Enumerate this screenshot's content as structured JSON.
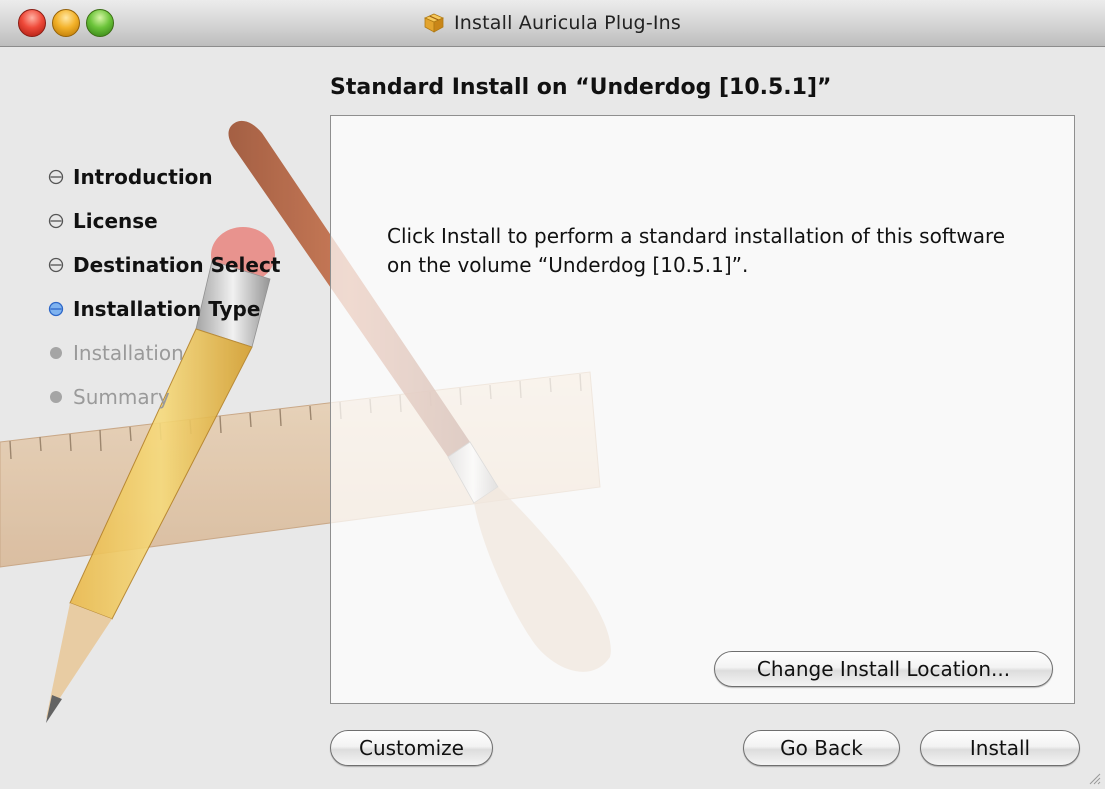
{
  "window": {
    "title": "Install Auricula Plug-Ins"
  },
  "heading": "Standard Install on “Underdog [10.5.1]”",
  "steps": [
    {
      "label": "Introduction",
      "state": "done"
    },
    {
      "label": "License",
      "state": "done"
    },
    {
      "label": "Destination Select",
      "state": "done"
    },
    {
      "label": "Installation Type",
      "state": "current"
    },
    {
      "label": "Installation",
      "state": "todo"
    },
    {
      "label": "Summary",
      "state": "todo"
    }
  ],
  "panel": {
    "message": "Click Install to perform a standard installation of this software on the volume “Underdog [10.5.1]”.",
    "change_location_label": "Change Install Location..."
  },
  "buttons": {
    "customize_label": "Customize",
    "go_back_label": "Go Back",
    "install_label": "Install"
  },
  "icons": {
    "title_icon": "package-icon",
    "step_current": "blue-bullet-icon",
    "step_done": "hollow-bullet-icon",
    "step_todo": "gray-bullet-icon"
  },
  "colors": {
    "accent_blue": "#3a7bd5",
    "inactive_gray": "#9a9a9a",
    "close": "#ef4a3a",
    "minimize": "#f3b22a",
    "zoom": "#6cc43a"
  }
}
